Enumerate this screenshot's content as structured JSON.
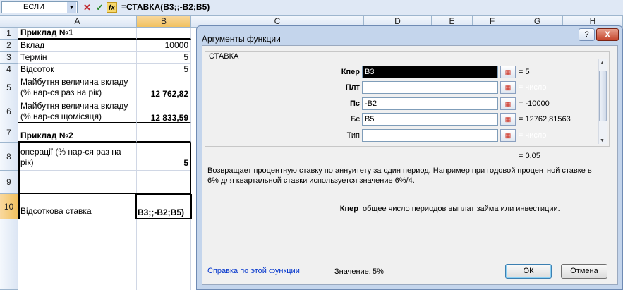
{
  "formula_bar": {
    "name_box": "ЕСЛИ",
    "cancel_icon": "✕",
    "enter_icon": "✓",
    "fx_icon": "fx",
    "formula": "=СТАВКА(B3;;-B2;B5)"
  },
  "columns": [
    "A",
    "B",
    "C",
    "D",
    "E",
    "F",
    "G",
    "H"
  ],
  "rows": [
    "1",
    "2",
    "3",
    "4",
    "5",
    "6",
    "7",
    "8",
    "9",
    "10"
  ],
  "sheet": {
    "a1": "Приклад №1",
    "a2": "Вклад",
    "b2": "10000",
    "a3": "Термін",
    "b3": "5",
    "a4": "Відсоток",
    "b4": "5",
    "a5_line1": "Майбутня величина вкладу",
    "a5_line2": "(% нар-ся раз на рік)",
    "b5": "12 762,82",
    "a6_line1": "Майбутня величина вкладу",
    "a6_line2": "(% нар-ся щомісяця)",
    "b6": "12 833,59",
    "a7": "Приклад №2",
    "a8_line1": "операції (% нар-ся раз на",
    "a8_line2": "рік)",
    "b8": "5",
    "a10": "Відсоткова ставка",
    "b10": "B3;;-B2;B5)"
  },
  "dialog": {
    "title": "Аргументы функции",
    "help_label": "?",
    "close_label": "X",
    "function_name": "СТАВКА",
    "args": [
      {
        "label": "Кпер",
        "bold": true,
        "value": "B3",
        "result": "= 5",
        "active": true
      },
      {
        "label": "Плт",
        "bold": true,
        "value": "",
        "result": "= число",
        "active": false
      },
      {
        "label": "Пс",
        "bold": true,
        "value": "-B2",
        "result": "= -10000",
        "active": false
      },
      {
        "label": "Бс",
        "bold": false,
        "value": "B5",
        "result": "= 12762,81563",
        "active": false
      },
      {
        "label": "Тип",
        "bold": false,
        "value": "",
        "result": "= число",
        "active": false
      }
    ],
    "total_result": "= 0,05",
    "description": "Возвращает процентную ставку по аннуитету за один период. Например при годовой процентной ставке в 6% для квартальной ставки используется значение 6%/4.",
    "arg_help_name": "Кпер",
    "arg_help_text": "общее число периодов выплат займа или инвестиции.",
    "help_link": "Справка по этой функции",
    "value_label": "Значение:",
    "value": "5%",
    "ok_label": "ОК",
    "cancel_label": "Отмена"
  },
  "colors": {
    "selection_header": "#f1c15f",
    "dialog_frame": "#c4d5ec",
    "close_button": "#c4442a",
    "link": "#0033cc"
  }
}
